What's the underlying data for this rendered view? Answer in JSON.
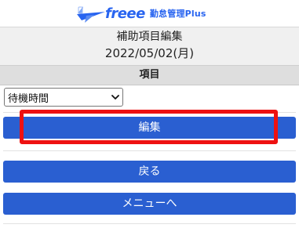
{
  "header": {
    "logo_brand": "freee",
    "logo_product": "勤怠管理Plus"
  },
  "title": {
    "line1": "補助項目編集",
    "line2": "2022/05/02(月)"
  },
  "section": {
    "label": "項目"
  },
  "item_select": {
    "selected": "待機時間"
  },
  "buttons": {
    "edit_label": "編集",
    "back_label": "戻る",
    "menu_label": "メニューへ"
  },
  "colors": {
    "brand": "#2864f0",
    "button_blue": "#2a5fd1",
    "highlight_red": "#ee1111"
  },
  "icons": {
    "logo": "freee-bird-logo-icon",
    "select_arrow": "chevron-down-icon"
  }
}
